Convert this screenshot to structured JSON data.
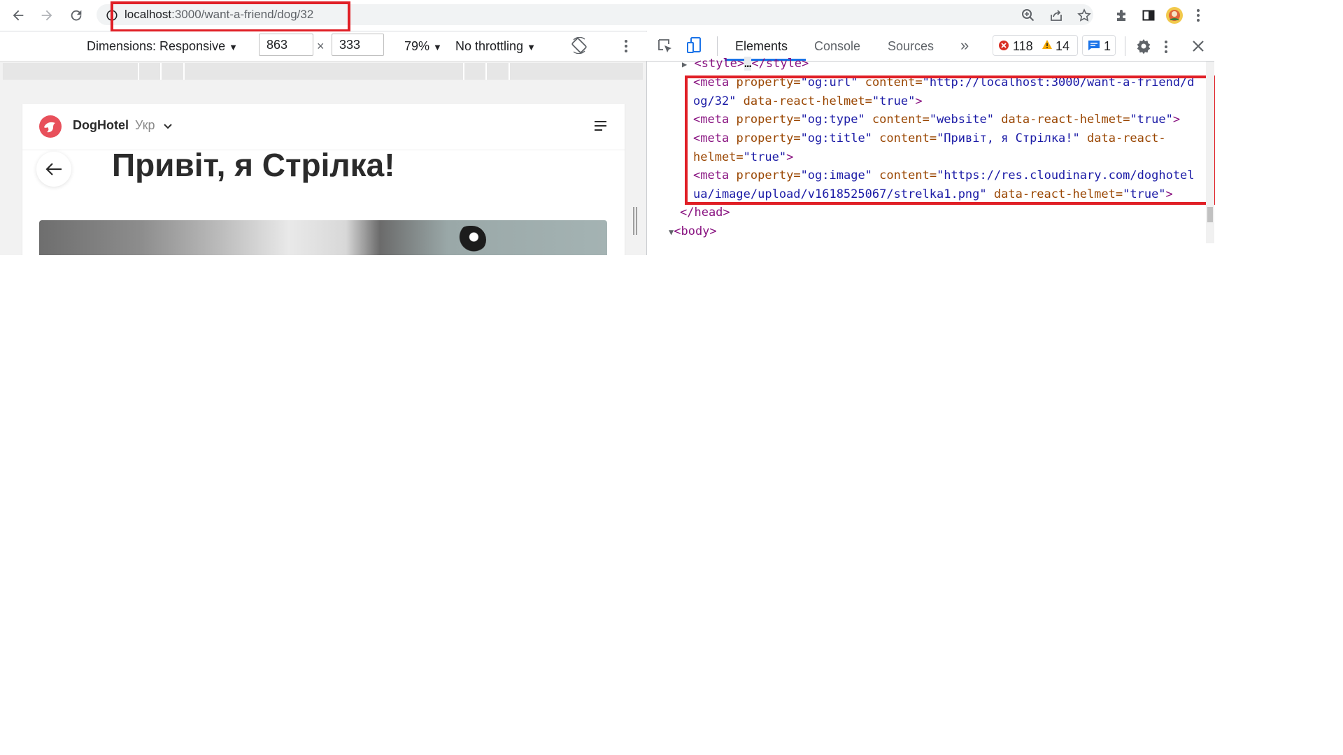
{
  "browser": {
    "url_host": "localhost",
    "url_path": ":3000/want-a-friend/dog/32",
    "icons": [
      "back-icon",
      "forward-icon",
      "reload-icon",
      "site-info-icon",
      "zoom-icon",
      "share-icon",
      "star-icon",
      "extensions-icon",
      "side-panel-icon",
      "profile-avatar",
      "menu-icon"
    ]
  },
  "device_toolbar": {
    "dimensions_label": "Dimensions: Responsive",
    "width": "863",
    "times": "×",
    "height": "333",
    "zoom": "79%",
    "throttling": "No throttling"
  },
  "page": {
    "brand": "DogHotel",
    "language": "Укр",
    "heading": "Привіт, я Стрілка!"
  },
  "devtools": {
    "tabs": [
      "Elements",
      "Console",
      "Sources"
    ],
    "more_tabs": "»",
    "errors": "118",
    "warnings": "14",
    "messages": "1",
    "code": {
      "style_line": {
        "open": "<style>",
        "ellipsis": "…",
        "close": "</style>"
      },
      "meta_url": {
        "tag": "<meta",
        "prop_attr": "property=",
        "prop_val": "\"og:url\"",
        "content_attr": "content=",
        "content_val_1": "\"http://localhost:3000/want-a-friend/d",
        "content_val_2": "og/32\"",
        "helmet_attr": "data-react-helmet=",
        "helmet_val": "\"true\"",
        "close": ">"
      },
      "meta_type": {
        "tag": "<meta",
        "prop_attr": "property=",
        "prop_val": "\"og:type\"",
        "content_attr": "content=",
        "content_val": "\"website\"",
        "helmet_attr": "data-react-helmet=",
        "helmet_val": "\"true\"",
        "close": ">"
      },
      "meta_title": {
        "tag": "<meta",
        "prop_attr": "property=",
        "prop_val": "\"og:title\"",
        "content_attr": "content=",
        "content_val": "\"Привіт, я Стрілка!\"",
        "helmet_attr_1": "data-react-",
        "helmet_attr_2": "helmet=",
        "helmet_val": "\"true\"",
        "close": ">"
      },
      "meta_image": {
        "tag": "<meta",
        "prop_attr": "property=",
        "prop_val": "\"og:image\"",
        "content_attr": "content=",
        "content_val_1": "\"https://res.cloudinary.com/doghotel",
        "content_val_2": "ua/image/upload/v1618525067/strelka1.png\"",
        "helmet_attr": "data-react-helmet=",
        "helmet_val": "\"true\"",
        "close": ">"
      },
      "head_close": "</head>",
      "body_open": "<body>"
    }
  },
  "colors": {
    "highlight": "#e01f26",
    "brand": "#e8505b",
    "tag": "#881280",
    "attr": "#994500",
    "value": "#1a1aa6"
  }
}
